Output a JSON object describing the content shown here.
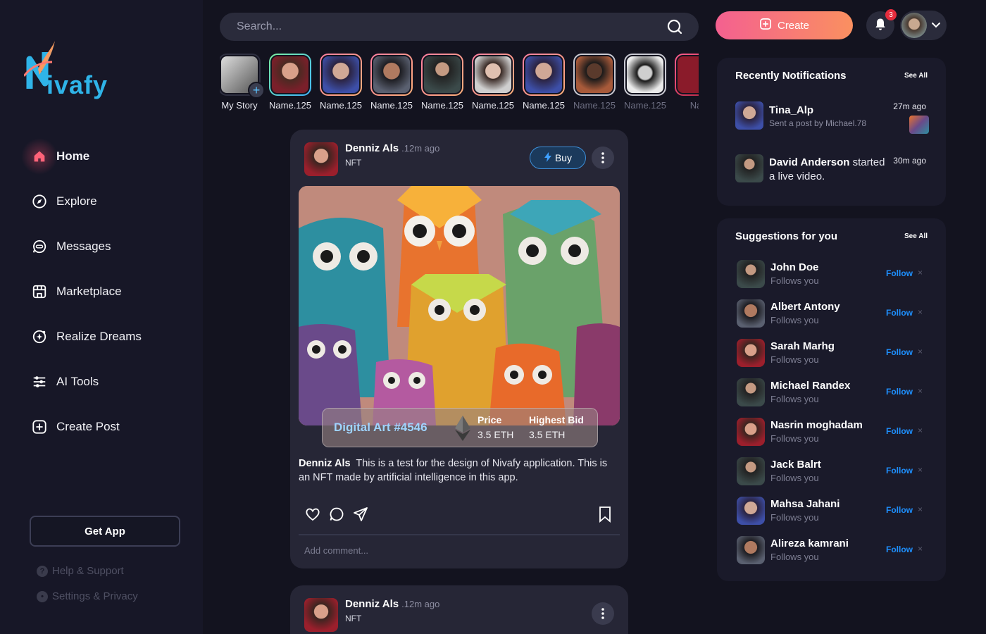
{
  "brand": {
    "name": "Nivafy",
    "logo_tail": "ivafy"
  },
  "nav": [
    {
      "label": "Home",
      "icon": "home-icon"
    },
    {
      "label": "Explore",
      "icon": "compass-icon"
    },
    {
      "label": "Messages",
      "icon": "chat-icon"
    },
    {
      "label": "Marketplace",
      "icon": "store-icon"
    },
    {
      "label": "Realize Dreams",
      "icon": "dream-icon"
    },
    {
      "label": "AI Tools",
      "icon": "sliders-icon"
    },
    {
      "label": "Create Post",
      "icon": "plus-square-icon"
    }
  ],
  "sidebar": {
    "get_app": "Get App",
    "help": "Help & Support",
    "settings": "Settings & Privacy"
  },
  "search": {
    "placeholder": "Search..."
  },
  "header": {
    "create": "Create",
    "notifications_count": "3"
  },
  "stories": [
    {
      "name": "My Story"
    },
    {
      "name": "Name.125"
    },
    {
      "name": "Name.125"
    },
    {
      "name": "Name.125"
    },
    {
      "name": "Name.125"
    },
    {
      "name": "Name.125"
    },
    {
      "name": "Name.125"
    },
    {
      "name": "Name.125"
    },
    {
      "name": "Name.125"
    },
    {
      "name": "Na"
    }
  ],
  "post": {
    "author": "Denniz Als",
    "time": ".12m ago",
    "tag": "NFT",
    "buy": "Buy",
    "nft_name": "Digital Art #4546",
    "price_label": "Price",
    "price_value": "3.5 ETH",
    "bid_label": "Highest Bid",
    "bid_value": "3.5 ETH",
    "caption": "This is a test for the design of Nivafy application. This is an NFT made by artificial intelligence in this app.",
    "comment_placeholder": "Add comment..."
  },
  "post2": {
    "author": "Denniz Als",
    "time": ".12m ago",
    "tag": "NFT"
  },
  "notifications": {
    "title": "Recently  Notifications",
    "see_all": "See All",
    "items": [
      {
        "title": "Tina_Alp",
        "sub": "Sent a post by Michael.78",
        "time": "27m ago"
      },
      {
        "name": "David Anderson",
        "text": " started a live video.",
        "time": "30m ago"
      }
    ]
  },
  "suggestions": {
    "title": "Suggestions for you",
    "see_all": "See All",
    "follow": "Follow",
    "close": "×",
    "items": [
      {
        "name": "John Doe",
        "sub": "Follows you"
      },
      {
        "name": "Albert Antony",
        "sub": "Follows you"
      },
      {
        "name": "Sarah Marhg",
        "sub": "Follows you"
      },
      {
        "name": "Michael Randex",
        "sub": "Follows you"
      },
      {
        "name": "Nasrin moghadam",
        "sub": "Follows you"
      },
      {
        "name": "Jack Balrt",
        "sub": "Follows you"
      },
      {
        "name": "Mahsa Jahani",
        "sub": "Follows you"
      },
      {
        "name": "Alireza kamrani",
        "sub": "Follows you"
      }
    ]
  },
  "colors": {
    "accent": "#f46090",
    "link": "#1e90ff",
    "brand": "#2fb4e8"
  }
}
